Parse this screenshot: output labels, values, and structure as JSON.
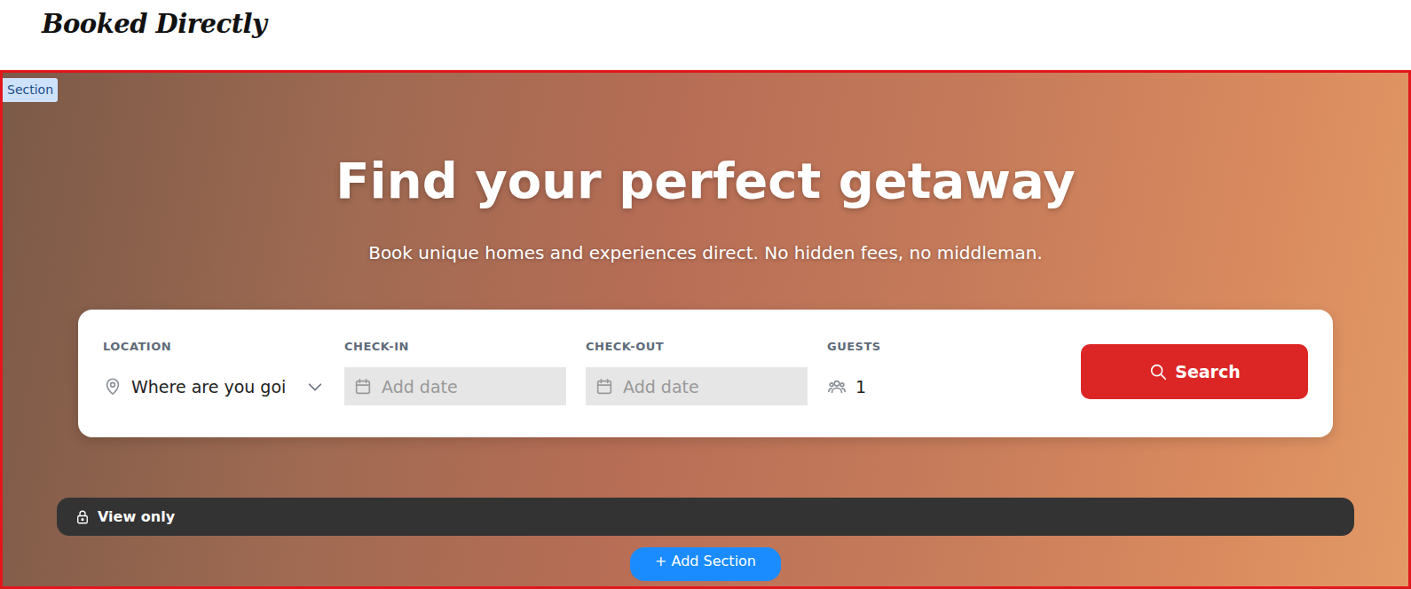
{
  "header": {
    "logo": "Booked Directly"
  },
  "section_badge": "Section",
  "hero": {
    "title": "Find your perfect getaway",
    "subtitle": "Book unique homes and experiences direct. No hidden fees, no middleman."
  },
  "search": {
    "fields": [
      {
        "kind": "select",
        "label": "LOCATION",
        "text": "Where are you goi"
      },
      {
        "kind": "date",
        "label": "CHECK-IN",
        "text": "Add date"
      },
      {
        "kind": "date",
        "label": "CHECK-OUT",
        "text": "Add date"
      },
      {
        "kind": "guests",
        "label": "GUESTS",
        "text": "1"
      }
    ],
    "button": "Search"
  },
  "view_only": "View only",
  "add_section": "+ Add Section"
}
